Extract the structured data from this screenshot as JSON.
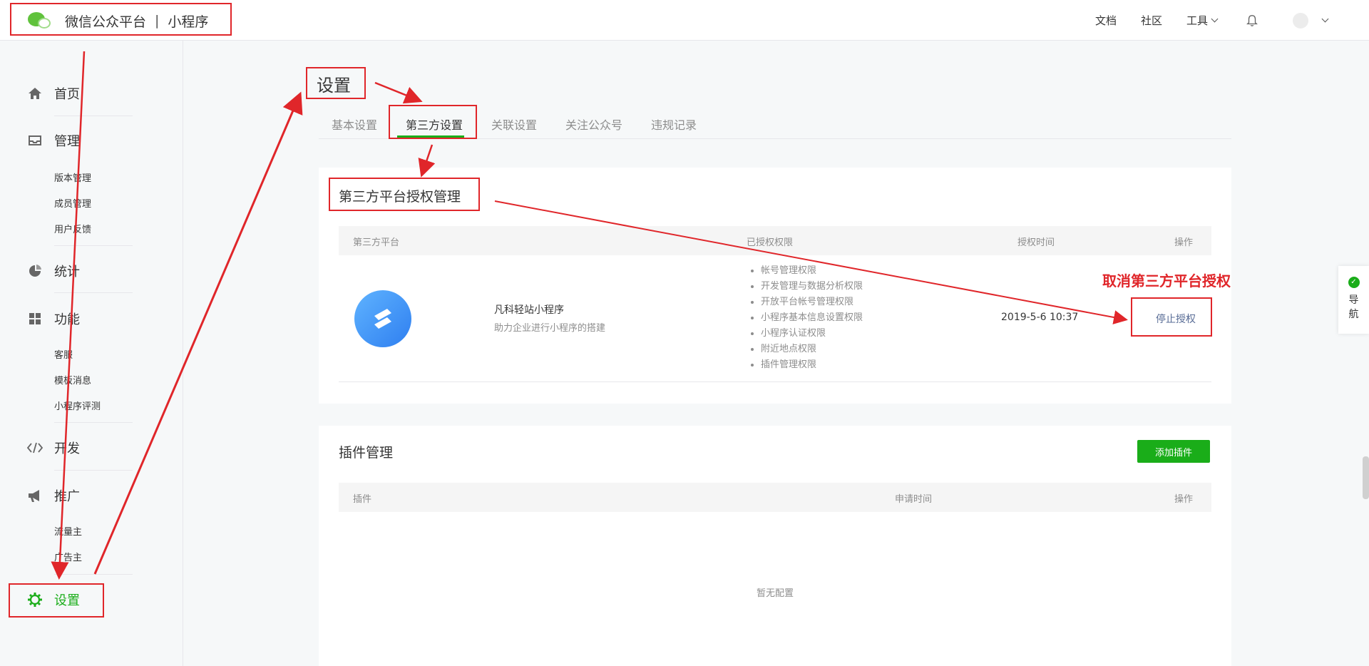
{
  "header": {
    "brand_title": "微信公众平台",
    "brand_separator": "|",
    "brand_sub": "小程序",
    "nav_docs": "文档",
    "nav_community": "社区",
    "nav_tools": "工具"
  },
  "sidebar": {
    "home": "首页",
    "manage": "管理",
    "manage_items": [
      "版本管理",
      "成员管理",
      "用户反馈"
    ],
    "stats": "统计",
    "features": "功能",
    "features_items": [
      "客服",
      "模板消息",
      "小程序评测"
    ],
    "dev": "开发",
    "promote": "推广",
    "promote_items": [
      "流量主",
      "广告主"
    ],
    "settings": "设置"
  },
  "page": {
    "title": "设置",
    "tabs": [
      "基本设置",
      "第三方设置",
      "关联设置",
      "关注公众号",
      "违规记录"
    ],
    "active_tab": "第三方设置"
  },
  "third_party": {
    "section_title": "第三方平台授权管理",
    "columns": [
      "第三方平台",
      "已授权权限",
      "授权时间",
      "操作"
    ],
    "rows": [
      {
        "name": "凡科轻站小程序",
        "desc": "助力企业进行小程序的搭建",
        "permissions": [
          "帐号管理权限",
          "开发管理与数据分析权限",
          "开放平台帐号管理权限",
          "小程序基本信息设置权限",
          "小程序认证权限",
          "附近地点权限",
          "插件管理权限"
        ],
        "time": "2019-5-6 10:37",
        "action": "停止授权"
      }
    ]
  },
  "plugins": {
    "section_title": "插件管理",
    "add_button": "添加插件",
    "columns": [
      "插件",
      "申请时间",
      "操作"
    ],
    "empty": "暂无配置"
  },
  "guide": {
    "label_1": "导",
    "label_2": "航"
  },
  "annotation": {
    "cancel_text": "取消第三方平台授权"
  },
  "colors": {
    "accent_green": "#1aad19",
    "link_blue": "#576b95",
    "annotation_red": "#e0262a"
  }
}
